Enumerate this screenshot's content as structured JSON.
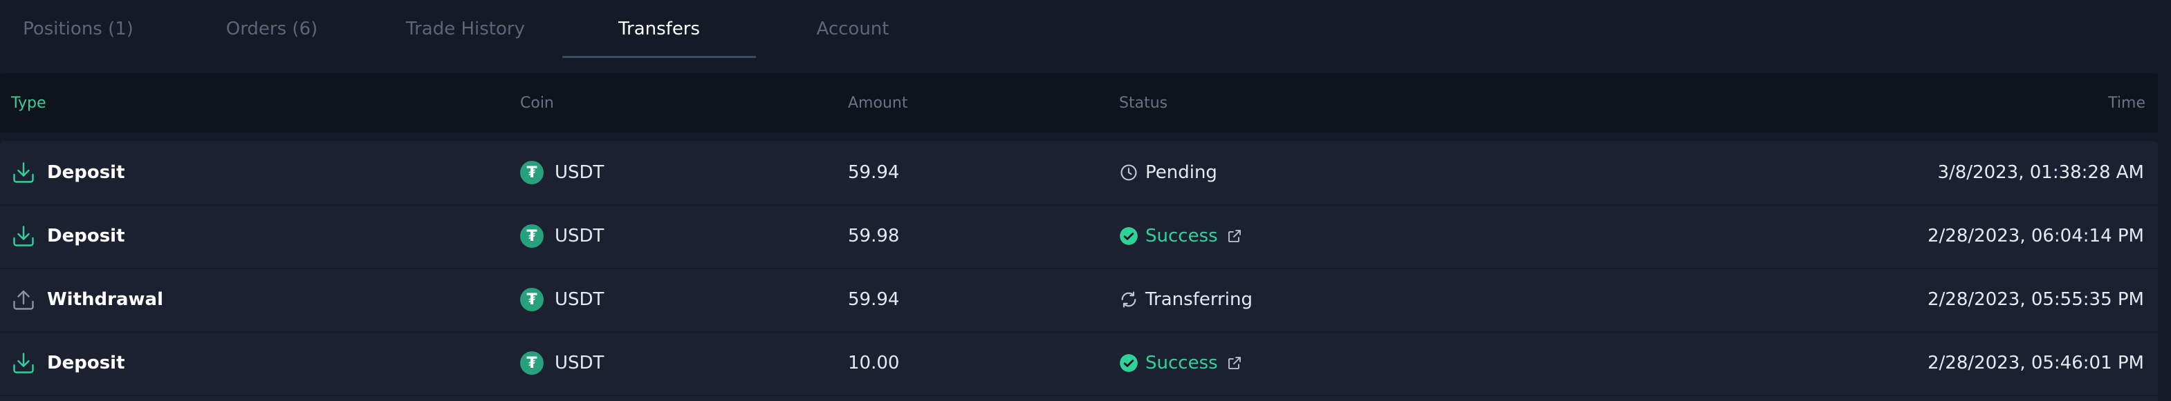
{
  "tabs": [
    {
      "label": "Positions (1)"
    },
    {
      "label": "Orders (6)"
    },
    {
      "label": "Trade History"
    },
    {
      "label": "Transfers"
    },
    {
      "label": "Account"
    }
  ],
  "active_tab": "Transfers",
  "columns": {
    "type": "Type",
    "coin": "Coin",
    "amount": "Amount",
    "status": "Status",
    "time": "Time"
  },
  "rows": [
    {
      "type": "Deposit",
      "type_icon": "deposit-icon",
      "coin": "USDT",
      "amount": "59.94",
      "status": "Pending",
      "status_icon": "clock-icon",
      "time": "3/8/2023, 01:38:28 AM"
    },
    {
      "type": "Deposit",
      "type_icon": "deposit-icon",
      "coin": "USDT",
      "amount": "59.98",
      "status": "Success",
      "status_icon": "check-circle-icon",
      "time": "2/28/2023, 06:04:14 PM"
    },
    {
      "type": "Withdrawal",
      "type_icon": "withdraw-icon",
      "coin": "USDT",
      "amount": "59.94",
      "status": "Transferring",
      "status_icon": "refresh-icon",
      "time": "2/28/2023, 05:55:35 PM"
    },
    {
      "type": "Deposit",
      "type_icon": "deposit-icon",
      "coin": "USDT",
      "amount": "10.00",
      "status": "Success",
      "status_icon": "check-circle-icon",
      "time": "2/28/2023, 05:46:01 PM"
    }
  ],
  "colors": {
    "accent": "#2fd39a",
    "background": "#141a26",
    "row": "#1b2130",
    "tether": "#26a17b"
  }
}
